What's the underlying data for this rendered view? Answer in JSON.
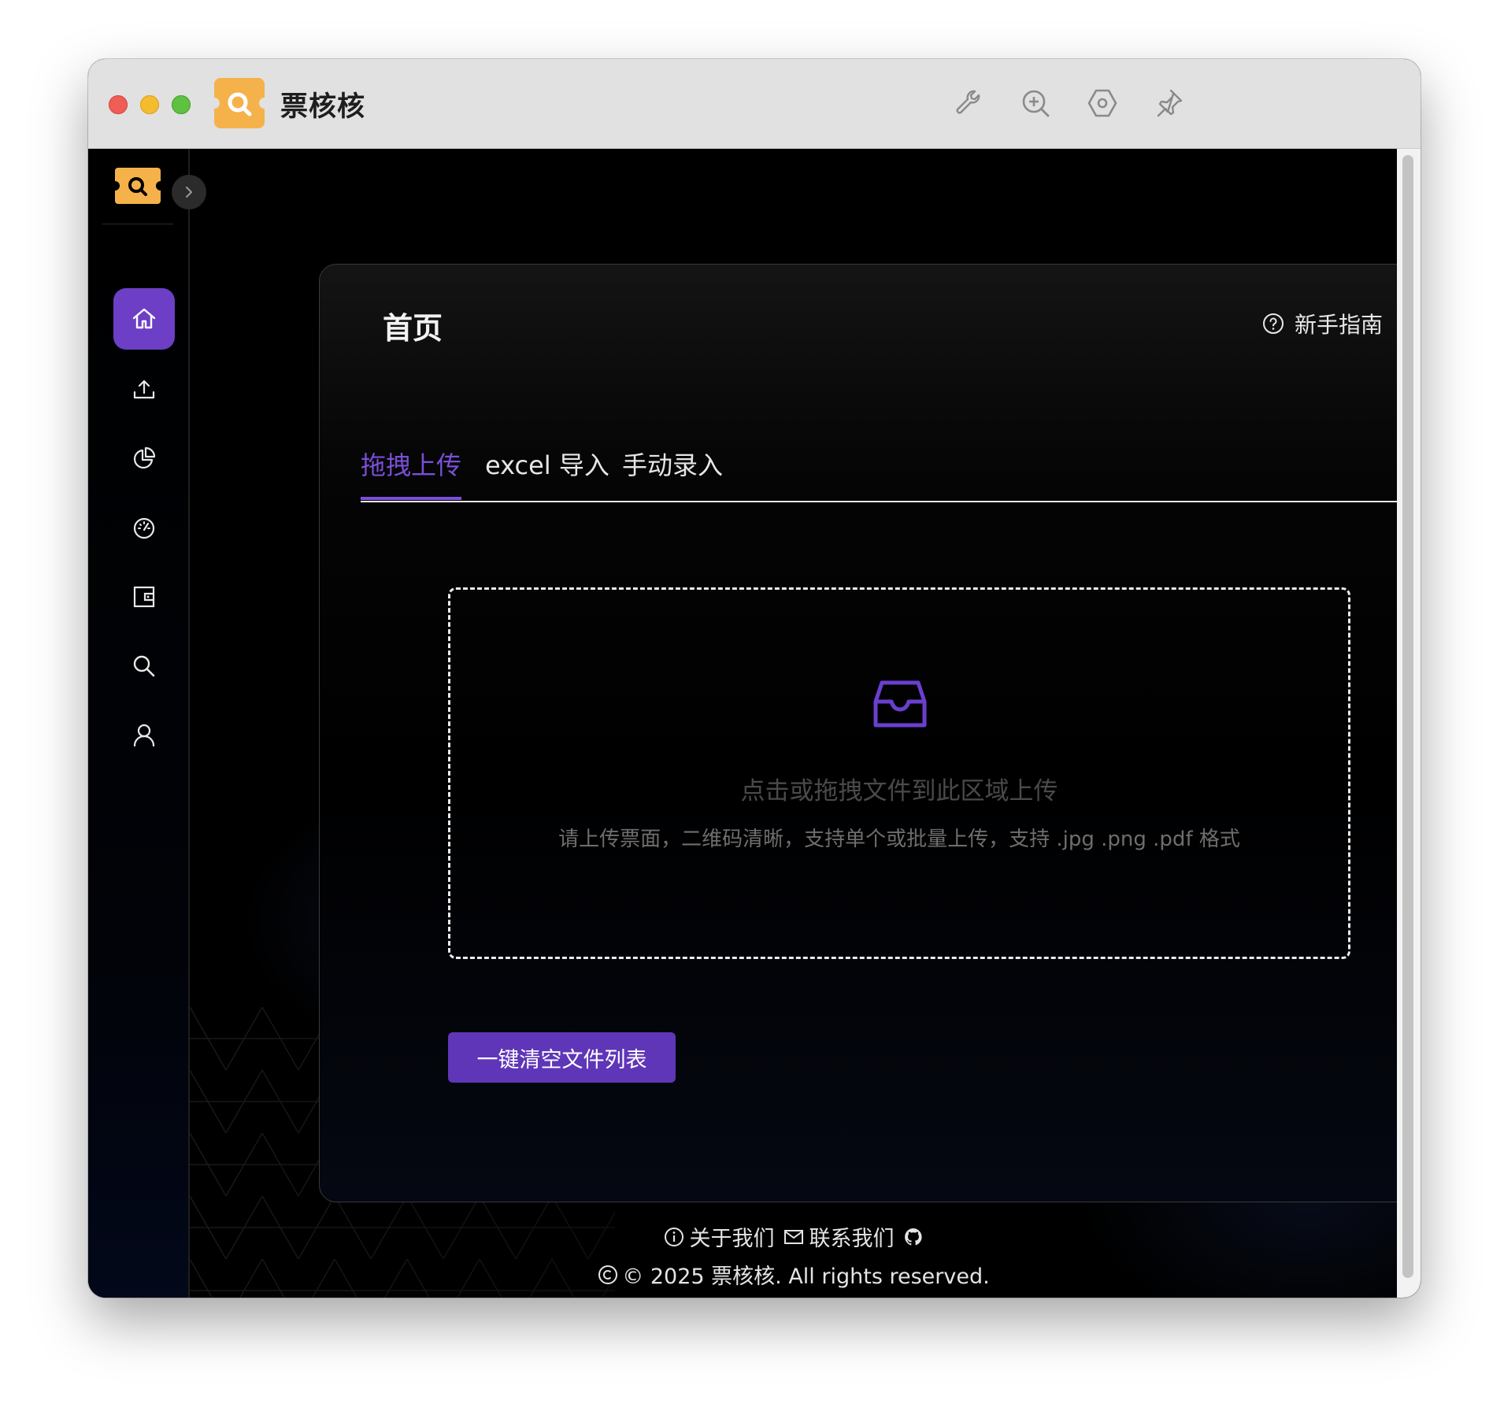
{
  "app": {
    "title": "票核核"
  },
  "page": {
    "title": "首页",
    "guide_label": "新手指南"
  },
  "tabs": [
    {
      "label": "拖拽上传"
    },
    {
      "label": "excel 导入"
    },
    {
      "label": "手动录入"
    }
  ],
  "dropzone": {
    "main_text": "点击或拖拽文件到此区域上传",
    "hint_text": "请上传票面，二维码清晰，支持单个或批量上传，支持 .jpg .png .pdf 格式"
  },
  "actions": {
    "clear_label": "一键清空文件列表"
  },
  "footer": {
    "about_label": "关于我们",
    "contact_label": "联系我们",
    "copyright": "© 2025 票核核. All rights reserved."
  },
  "sidebar": {
    "items": [
      {
        "icon": "home-icon",
        "active": true
      },
      {
        "icon": "upload-icon"
      },
      {
        "icon": "pie-chart-icon"
      },
      {
        "icon": "dashboard-icon"
      },
      {
        "icon": "wallet-icon"
      },
      {
        "icon": "search-icon"
      },
      {
        "icon": "user-icon"
      }
    ]
  },
  "titlebar_icons": [
    "wrench-icon",
    "zoom-in-icon",
    "settings-hex-icon",
    "pin-icon"
  ],
  "colors": {
    "accent": "#7a4fd6",
    "button": "#5f36b8",
    "logo": "#f5b24a"
  }
}
